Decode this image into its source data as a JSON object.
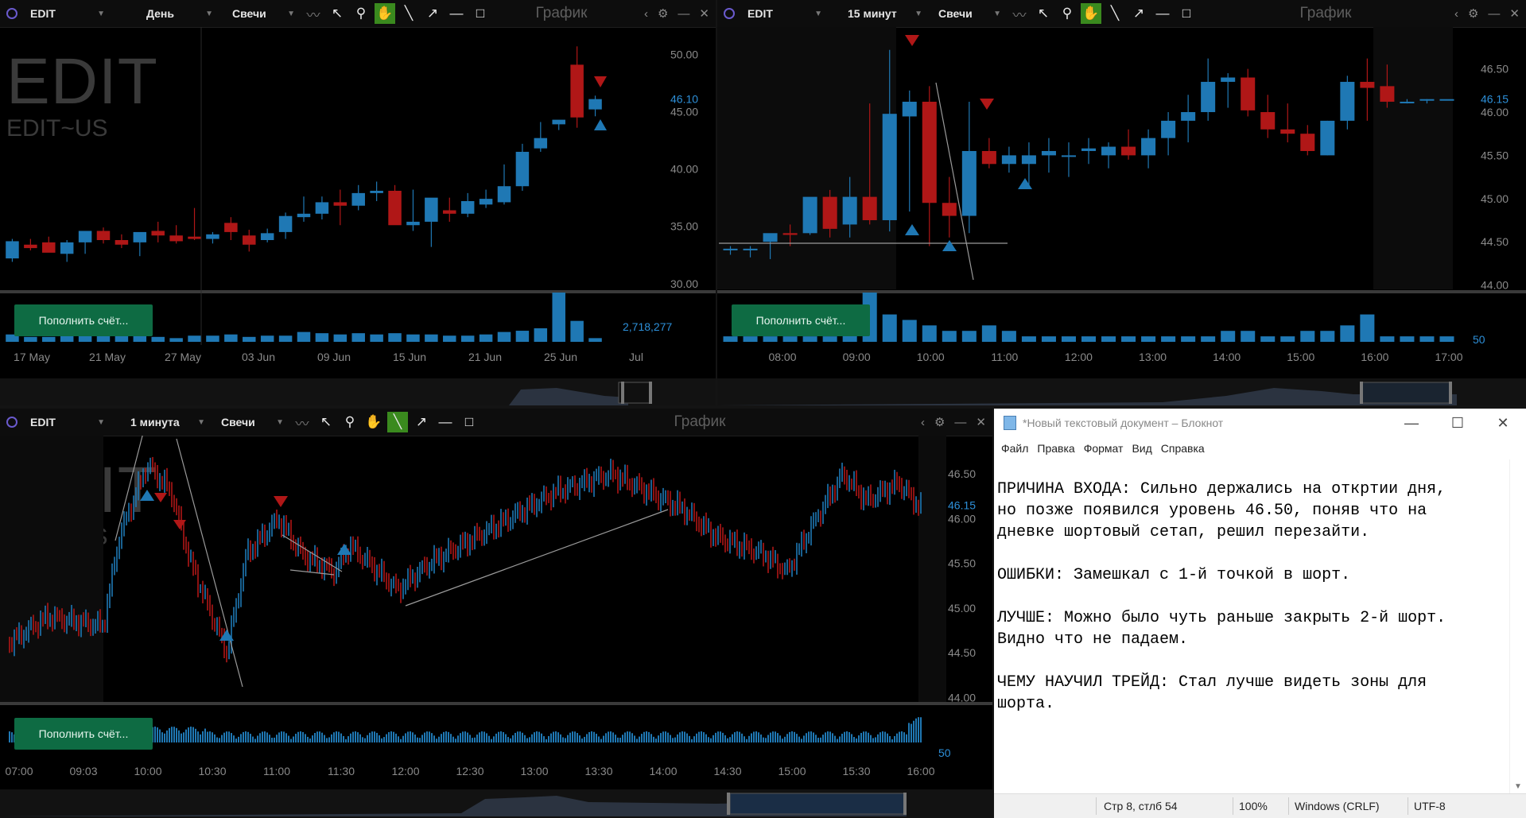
{
  "colors": {
    "up": "#1f78b4",
    "down": "#b01717",
    "volume": "#1f78b4",
    "axis_text": "#8a8a8a",
    "price_label": "#2d8fd8",
    "deposit": "#0e6b43"
  },
  "panels": [
    {
      "id": "p1",
      "symbol": "EDIT",
      "interval": "День",
      "chart_type": "Свечи",
      "title": "График",
      "watermark": "EDIT",
      "watermark_sub": "EDIT~US",
      "deposit_label": "Пополнить счёт...",
      "volume_label": "2,718,277",
      "last_price": "46.10",
      "y_ticks": [
        "50.00",
        "45.00",
        "40.00",
        "35.00",
        "30.00"
      ],
      "x_ticks": [
        "17 May",
        "21 May",
        "27 May",
        "03 Jun",
        "09 Jun",
        "15 Jun",
        "21 Jun",
        "25 Jun",
        "Jul"
      ]
    },
    {
      "id": "p2",
      "symbol": "EDIT",
      "interval": "15 минут",
      "chart_type": "Свечи",
      "title": "График",
      "watermark": "EDIT",
      "watermark_sub": "EDIT~US",
      "deposit_label": "Пополнить счёт...",
      "volume_label": "50",
      "last_price": "46.15",
      "y_ticks": [
        "46.50",
        "46.00",
        "45.50",
        "45.00",
        "44.50",
        "44.00"
      ],
      "x_ticks": [
        "08:00",
        "09:00",
        "10:00",
        "11:00",
        "12:00",
        "13:00",
        "14:00",
        "15:00",
        "16:00",
        "17:00"
      ]
    },
    {
      "id": "p3",
      "symbol": "EDIT",
      "interval": "1 минута",
      "chart_type": "Свечи",
      "title": "График",
      "watermark": "EDIT",
      "watermark_sub": "EDIT~US",
      "deposit_label": "Пополнить счёт...",
      "volume_label": "50",
      "last_price": "46.15",
      "y_ticks": [
        "46.50",
        "46.00",
        "45.50",
        "45.00",
        "44.50",
        "44.00"
      ],
      "x_ticks": [
        "07:00",
        "09:03",
        "10:00",
        "10:30",
        "11:00",
        "11:30",
        "12:00",
        "12:30",
        "13:00",
        "13:30",
        "14:00",
        "14:30",
        "15:00",
        "15:30",
        "16:00"
      ]
    }
  ],
  "toolbar_icons": [
    "line-chart-icon",
    "cursor-icon",
    "zoom-icon",
    "hand-icon",
    "trendline-icon",
    "arrow-icon",
    "hline-icon",
    "rectangle-icon"
  ],
  "chart_data": [
    {
      "type": "candlestick",
      "title": "EDIT~US День",
      "x": [
        "17 May",
        "18 May",
        "19 May",
        "20 May",
        "21 May",
        "24 May",
        "25 May",
        "26 May",
        "27 May",
        "28 May",
        "01 Jun",
        "02 Jun",
        "03 Jun",
        "04 Jun",
        "07 Jun",
        "08 Jun",
        "09 Jun",
        "10 Jun",
        "11 Jun",
        "14 Jun",
        "15 Jun",
        "16 Jun",
        "17 Jun",
        "18 Jun",
        "21 Jun",
        "22 Jun",
        "23 Jun",
        "24 Jun",
        "25 Jun",
        "28 Jun",
        "29 Jun",
        "30 Jun",
        "01 Jul"
      ],
      "open": [
        32.2,
        33.4,
        33.6,
        32.6,
        33.6,
        34.6,
        33.8,
        33.6,
        34.6,
        34.2,
        34.1,
        33.9,
        35.3,
        34.2,
        33.8,
        34.5,
        35.8,
        36.1,
        37.1,
        36.8,
        37.9,
        38.1,
        35.1,
        35.4,
        36.4,
        36.1,
        36.9,
        37.1,
        38.5,
        41.8,
        43.9,
        49.1,
        45.2
      ],
      "high": [
        33.9,
        33.9,
        34.1,
        33.8,
        34.3,
        34.9,
        34.3,
        34.2,
        35.4,
        35.1,
        36.6,
        34.5,
        35.8,
        34.7,
        34.8,
        36.2,
        37.6,
        37.6,
        38.2,
        38.6,
        38.9,
        38.6,
        38.2,
        37.2,
        37.5,
        37.9,
        38.2,
        40.4,
        42.2,
        44.1,
        44.2,
        50.7,
        46.4
      ],
      "low": [
        31.9,
        32.9,
        32.9,
        31.9,
        32.6,
        33.5,
        33.1,
        32.4,
        33.6,
        33.5,
        33.8,
        33.5,
        33.8,
        32.8,
        33.6,
        33.9,
        35.4,
        35.6,
        35.1,
        36.4,
        37.2,
        35.4,
        34.6,
        33.2,
        35.4,
        35.8,
        36.6,
        36.9,
        38.1,
        41.5,
        43.4,
        43.6,
        44.6
      ],
      "close": [
        33.7,
        33.1,
        32.7,
        33.6,
        34.6,
        33.8,
        33.4,
        34.5,
        34.2,
        33.7,
        33.9,
        34.3,
        34.5,
        33.4,
        34.4,
        35.9,
        36.1,
        37.1,
        36.8,
        37.9,
        38.1,
        35.1,
        35.4,
        37.5,
        36.1,
        37.2,
        37.4,
        38.5,
        41.5,
        42.7,
        44.3,
        44.5,
        46.1
      ],
      "volume": [
        6,
        4,
        4,
        5,
        5,
        6,
        5,
        5,
        4,
        3,
        5,
        5,
        6,
        4,
        5,
        5,
        8,
        7,
        6,
        7,
        6,
        7,
        6,
        6,
        5,
        5,
        6,
        8,
        9,
        11,
        40,
        17,
        3
      ],
      "y_range": [
        29.5,
        51
      ]
    },
    {
      "type": "candlestick",
      "title": "EDIT~US 15 минут",
      "x": [
        "08:00",
        "08:15",
        "08:30",
        "08:45",
        "09:00",
        "09:15",
        "09:30",
        "09:45",
        "10:00",
        "10:15",
        "10:30",
        "10:45",
        "11:00",
        "11:15",
        "11:30",
        "11:45",
        "12:00",
        "12:15",
        "12:30",
        "12:45",
        "13:00",
        "13:15",
        "13:30",
        "13:45",
        "14:00",
        "14:15",
        "14:30",
        "14:45",
        "15:00",
        "15:15",
        "15:30",
        "15:45",
        "16:00",
        "16:15",
        "16:30",
        "16:45",
        "17:00"
      ],
      "open": [
        44.42,
        44.42,
        44.5,
        44.6,
        44.6,
        45.02,
        44.7,
        45.02,
        44.75,
        45.95,
        46.12,
        44.95,
        44.8,
        45.55,
        45.4,
        45.4,
        45.5,
        45.5,
        45.55,
        45.5,
        45.6,
        45.5,
        45.7,
        45.9,
        46.0,
        46.35,
        46.4,
        46.0,
        45.8,
        45.75,
        45.5,
        45.9,
        46.35,
        46.3,
        46.12,
        46.15,
        46.15
      ],
      "high": [
        44.45,
        44.45,
        44.55,
        44.7,
        44.82,
        45.1,
        45.25,
        46.1,
        46.72,
        46.25,
        46.3,
        45.25,
        46.12,
        45.7,
        45.6,
        45.65,
        45.7,
        45.65,
        45.7,
        45.65,
        45.8,
        45.8,
        46.0,
        46.2,
        46.62,
        46.45,
        46.5,
        46.2,
        46.1,
        45.85,
        45.9,
        46.42,
        46.62,
        46.55,
        46.15,
        46.15,
        46.15
      ],
      "low": [
        44.35,
        44.32,
        44.3,
        44.45,
        44.58,
        44.55,
        44.55,
        44.7,
        44.62,
        44.85,
        44.45,
        44.55,
        44.6,
        45.35,
        45.3,
        45.15,
        45.3,
        45.25,
        45.4,
        45.35,
        45.45,
        45.35,
        45.5,
        45.65,
        45.9,
        46.05,
        45.95,
        45.7,
        45.65,
        45.5,
        45.5,
        45.8,
        45.9,
        46.05,
        46.1,
        46.1,
        46.15
      ],
      "close": [
        44.42,
        44.42,
        44.6,
        44.58,
        45.02,
        44.65,
        45.02,
        44.75,
        45.98,
        46.12,
        44.95,
        44.8,
        45.55,
        45.4,
        45.5,
        45.5,
        45.55,
        45.5,
        45.58,
        45.6,
        45.5,
        45.7,
        45.9,
        46.0,
        46.35,
        46.4,
        46.02,
        45.8,
        45.75,
        45.55,
        45.9,
        46.35,
        46.28,
        46.12,
        46.12,
        46.15,
        46.15
      ],
      "volume": [
        1,
        1,
        1,
        1,
        1,
        1,
        2,
        9,
        5,
        4,
        3,
        2,
        2,
        3,
        2,
        1,
        1,
        1,
        1,
        1,
        1,
        1,
        1,
        1,
        1,
        2,
        2,
        1,
        1,
        2,
        2,
        3,
        5,
        1,
        1,
        1,
        1
      ],
      "y_range": [
        43.95,
        46.8
      ]
    }
  ],
  "notepad": {
    "title": "*Новый текстовый документ – Блокнот",
    "menu": [
      "Файл",
      "Правка",
      "Формат",
      "Вид",
      "Справка"
    ],
    "text": "ПРИЧИНА ВХОДА: Сильно держались на откртии дня,\nно позже появился уровень 46.50, поняв что на\nдневке шортовый сетап, решил перезайти.\n\nОШИБКИ: Замешкал с 1-й точкой в шорт.\n\nЛУЧШЕ: Можно было чуть раньше закрыть 2-й шорт.\nВидно что не падаем.\n\nЧЕМУ НАУЧИЛ ТРЕЙД: Стал лучше видеть зоны для\nшорта.",
    "status": {
      "position": "Стр 8, стлб 54",
      "zoom": "100%",
      "line_endings": "Windows (CRLF)",
      "encoding": "UTF-8"
    }
  }
}
